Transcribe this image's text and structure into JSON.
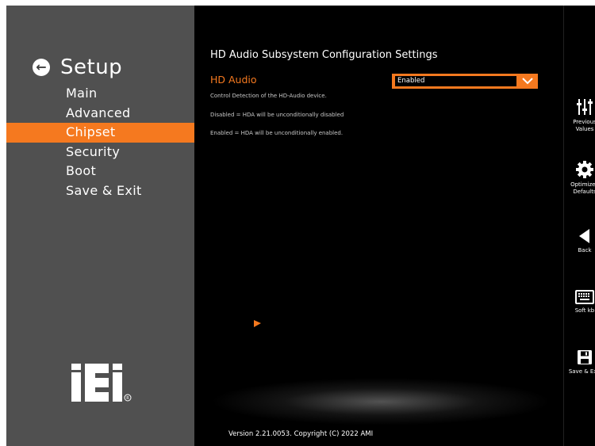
{
  "sidebar": {
    "title": "Setup",
    "items": [
      {
        "label": "Main",
        "active": false
      },
      {
        "label": "Advanced",
        "active": false
      },
      {
        "label": "Chipset",
        "active": true
      },
      {
        "label": "Security",
        "active": false
      },
      {
        "label": "Boot",
        "active": false
      },
      {
        "label": "Save & Exit",
        "active": false
      }
    ],
    "logo_text": "iEi"
  },
  "main": {
    "section_title": "HD Audio Subsystem Configuration Settings",
    "setting_label": "HD Audio",
    "setting_value": "Enabled",
    "help_lines": [
      "Control Detection of the HD-Audio device.",
      "Disabled = HDA will be unconditionally disabled",
      "Enabled = HDA will be unconditionally enabled."
    ],
    "footer": "Version 2.21.0053. Copyright (C) 2022 AMI"
  },
  "toolbar": {
    "previous_values": "Previous\nValues",
    "optimized_defaults": "Optimized\nDefaults",
    "back": "Back",
    "soft_kb": "Soft kb",
    "save_exit": "Save & Exit"
  },
  "colors": {
    "accent": "#f5791f",
    "sidebar_bg": "#505050",
    "main_bg": "#000000"
  }
}
